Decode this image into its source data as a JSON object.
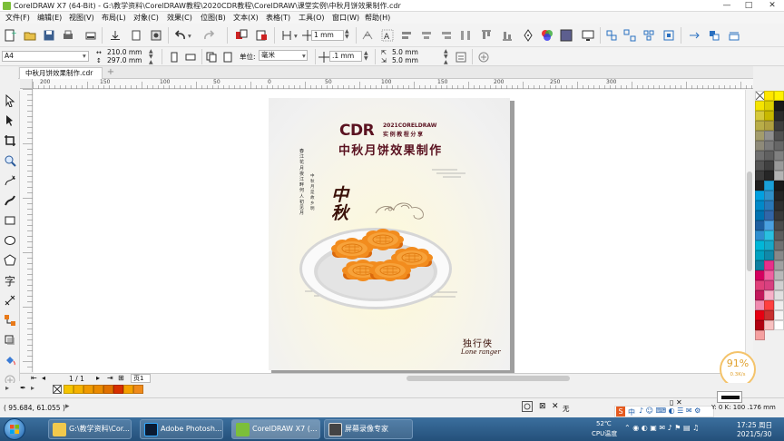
{
  "window": {
    "title": "CorelDRAW X7 (64-Bit) - G:\\教学资料\\CorelDRAW教程\\2020CDR教程\\CorelDRAW\\课堂实例\\中秋月饼效果制作.cdr",
    "minimize": "—",
    "maximize": "□",
    "close": "✕"
  },
  "menubar": [
    "文件(F)",
    "编辑(E)",
    "视图(V)",
    "布局(L)",
    "对象(C)",
    "效果(C)",
    "位图(B)",
    "文本(X)",
    "表格(T)",
    "工具(O)",
    "窗口(W)"
  ],
  "menu_right": "帮助(H)",
  "toolbar": {
    "nudge_value": "1 mm",
    "page_size": "A4",
    "width": "210.0 mm",
    "height": "297.0 mm",
    "units_label": "单位:",
    "units": "毫米",
    "nudge_small": ".1 mm",
    "dup_x": "5.0 mm",
    "dup_y": "5.0 mm"
  },
  "doc_tab": "中秋月饼效果制作.cdr",
  "ruler_labels": [
    "200",
    "150",
    "100",
    "50",
    "0",
    "50",
    "100",
    "150",
    "200",
    "250",
    "300"
  ],
  "artwork": {
    "cdr": "CDR",
    "year_line": "2021CORELDRAW",
    "subtitle_line": "实例教程分享",
    "headline": "中秋月饼效果制作",
    "calligraphy": "中秋",
    "poem_left": "春江花月夜 江畔何人初见月",
    "poem_right": "中秋 月是故乡明",
    "brand_cn": "独行侠",
    "brand_en": "Lone ranger"
  },
  "pagenav": {
    "page_count": "1 / 1",
    "page_tab": "页1"
  },
  "progress": {
    "percent": "91%",
    "rate": "0.3K/s",
    "fraction": 0.91
  },
  "status": {
    "coords": "( 95.684, 61.055 )",
    "fill_none": "无",
    "cmyk": "Y: 0 K: 100  .176 mm"
  },
  "taskbar": {
    "items": [
      "G:\\教学资料\\Cor...",
      "Adobe Photosh...",
      "CorelDRAW X7 (...",
      "屏幕录像专家"
    ],
    "temp": "52℃",
    "temp_label": "CPU温度",
    "time": "17:25 周日",
    "date": "2021/5/30",
    "ime": "中"
  },
  "colors": {
    "accent": "#7cbf3a",
    "title_red": "#5a1220",
    "mooncake": "#f28c1e",
    "taskbar": "#2f6190"
  }
}
